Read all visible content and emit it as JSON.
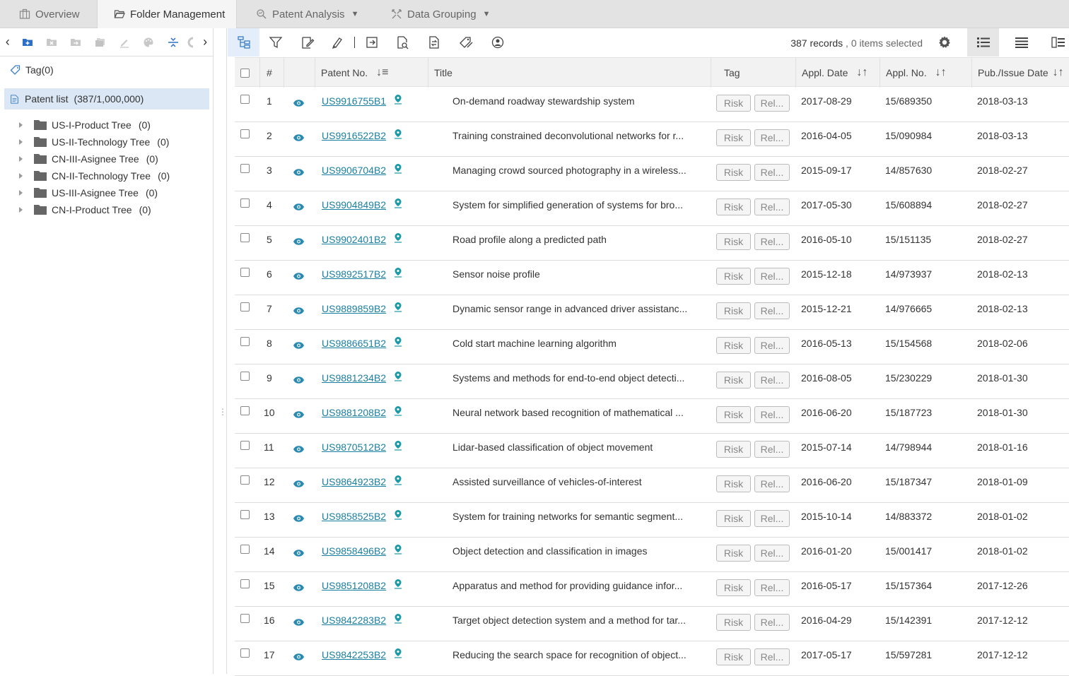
{
  "tabs": [
    {
      "label": "Overview",
      "icon": "briefcase-icon"
    },
    {
      "label": "Folder Management",
      "icon": "folder-open-icon"
    },
    {
      "label": "Patent Analysis",
      "icon": "analysis-icon"
    },
    {
      "label": "Data Grouping",
      "icon": "grouping-icon"
    }
  ],
  "left": {
    "tag_label": "Tag",
    "tag_count": "(0)",
    "patent_list_label": "Patent list",
    "patent_list_count": "(387/1,000,000)",
    "tree": [
      {
        "label": "US-I-Product Tree",
        "count": "(0)"
      },
      {
        "label": "US-II-Technology Tree",
        "count": "(0)"
      },
      {
        "label": "CN-III-Asignee Tree",
        "count": "(0)"
      },
      {
        "label": "CN-II-Technology Tree",
        "count": "(0)"
      },
      {
        "label": "US-III-Asignee Tree",
        "count": "(0)"
      },
      {
        "label": "CN-I-Product Tree",
        "count": "(0)"
      }
    ]
  },
  "toolbar": {
    "records_count": "387 records",
    "separator": ",",
    "selected": "0 items selected"
  },
  "table": {
    "headers": {
      "num": "#",
      "patent_no": "Patent No.",
      "title": "Title",
      "tag": "Tag",
      "appl_date": "Appl. Date",
      "appl_no": "Appl. No.",
      "pub_date": "Pub./Issue Date"
    },
    "tag_buttons": {
      "risk": "Risk",
      "rel": "Rel..."
    },
    "rows": [
      {
        "num": "1",
        "patent_no": "US9916755B1",
        "title": "On-demand roadway stewardship system",
        "appl_date": "2017-08-29",
        "appl_no": "15/689350",
        "pub_date": "2018-03-13"
      },
      {
        "num": "2",
        "patent_no": "US9916522B2",
        "title": "Training constrained deconvolutional networks for r...",
        "appl_date": "2016-04-05",
        "appl_no": "15/090984",
        "pub_date": "2018-03-13"
      },
      {
        "num": "3",
        "patent_no": "US9906704B2",
        "title": "Managing crowd sourced photography in a wireless...",
        "appl_date": "2015-09-17",
        "appl_no": "14/857630",
        "pub_date": "2018-02-27"
      },
      {
        "num": "4",
        "patent_no": "US9904849B2",
        "title": "System for simplified generation of systems for bro...",
        "appl_date": "2017-05-30",
        "appl_no": "15/608894",
        "pub_date": "2018-02-27"
      },
      {
        "num": "5",
        "patent_no": "US9902401B2",
        "title": "Road profile along a predicted path",
        "appl_date": "2016-05-10",
        "appl_no": "15/151135",
        "pub_date": "2018-02-27"
      },
      {
        "num": "6",
        "patent_no": "US9892517B2",
        "title": "Sensor noise profile",
        "appl_date": "2015-12-18",
        "appl_no": "14/973937",
        "pub_date": "2018-02-13"
      },
      {
        "num": "7",
        "patent_no": "US9889859B2",
        "title": "Dynamic sensor range in advanced driver assistanc...",
        "appl_date": "2015-12-21",
        "appl_no": "14/976665",
        "pub_date": "2018-02-13"
      },
      {
        "num": "8",
        "patent_no": "US9886651B2",
        "title": "Cold start machine learning algorithm",
        "appl_date": "2016-05-13",
        "appl_no": "15/154568",
        "pub_date": "2018-02-06"
      },
      {
        "num": "9",
        "patent_no": "US9881234B2",
        "title": "Systems and methods for end-to-end object detecti...",
        "appl_date": "2016-08-05",
        "appl_no": "15/230229",
        "pub_date": "2018-01-30"
      },
      {
        "num": "10",
        "patent_no": "US9881208B2",
        "title": "Neural network based recognition of mathematical ...",
        "appl_date": "2016-06-20",
        "appl_no": "15/187723",
        "pub_date": "2018-01-30"
      },
      {
        "num": "11",
        "patent_no": "US9870512B2",
        "title": "Lidar-based classification of object movement",
        "appl_date": "2015-07-14",
        "appl_no": "14/798944",
        "pub_date": "2018-01-16"
      },
      {
        "num": "12",
        "patent_no": "US9864923B2",
        "title": "Assisted surveillance of vehicles-of-interest",
        "appl_date": "2016-06-20",
        "appl_no": "15/187347",
        "pub_date": "2018-01-09"
      },
      {
        "num": "13",
        "patent_no": "US9858525B2",
        "title": "System for training networks for semantic segment...",
        "appl_date": "2015-10-14",
        "appl_no": "14/883372",
        "pub_date": "2018-01-02"
      },
      {
        "num": "14",
        "patent_no": "US9858496B2",
        "title": "Object detection and classification in images",
        "appl_date": "2016-01-20",
        "appl_no": "15/001417",
        "pub_date": "2018-01-02"
      },
      {
        "num": "15",
        "patent_no": "US9851208B2",
        "title": "Apparatus and method for providing guidance infor...",
        "appl_date": "2016-05-17",
        "appl_no": "15/157364",
        "pub_date": "2017-12-26"
      },
      {
        "num": "16",
        "patent_no": "US9842283B2",
        "title": "Target object detection system and a method for tar...",
        "appl_date": "2016-04-29",
        "appl_no": "15/142391",
        "pub_date": "2017-12-12"
      },
      {
        "num": "17",
        "patent_no": "US9842253B2",
        "title": "Reducing the search space for recognition of object...",
        "appl_date": "2017-05-17",
        "appl_no": "15/597281",
        "pub_date": "2017-12-12"
      }
    ]
  }
}
